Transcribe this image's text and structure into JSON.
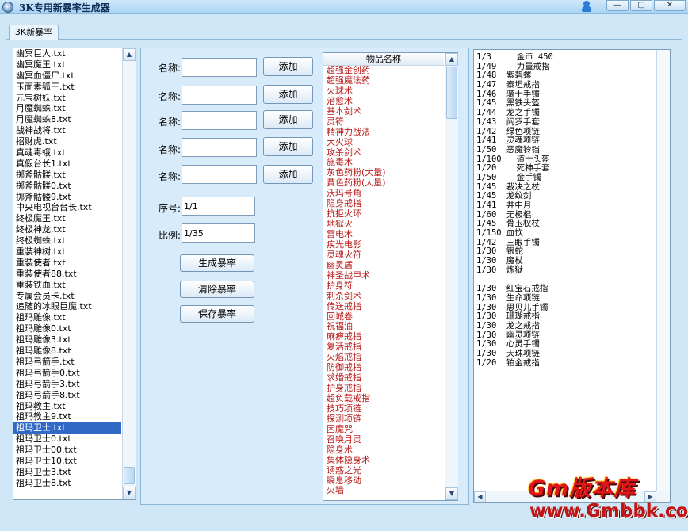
{
  "window": {
    "title": "3K专用新暴率生成器",
    "min_label": "—",
    "max_label": "▢",
    "close_label": "✕"
  },
  "tab": {
    "label": "3K新暴率"
  },
  "file_list": {
    "items": [
      "幽冥巨人.txt",
      "幽冥魔王.txt",
      "幽冥血僵尸.txt",
      "玉面素狐王.txt",
      "元宝树妖.txt",
      "月魔蜘蛛.txt",
      "月魔蜘蛛8.txt",
      "战神战将.txt",
      "招财虎.txt",
      "真魂毒蛾.txt",
      "真假台长1.txt",
      "掷斧骷髅.txt",
      "掷斧骷髅0.txt",
      "掷斧骷髅9.txt",
      "中央电视台台长.txt",
      "终极魔王.txt",
      "终极神龙.txt",
      "终极蜘蛛.txt",
      "重装神树.txt",
      "重装使者.txt",
      "重装使者88.txt",
      "重装铁血.txt",
      "专属会员卡.txt",
      "追随的冰眼巨魔.txt",
      "祖玛雕像.txt",
      "祖玛雕像0.txt",
      "祖玛雕像3.txt",
      "祖玛雕像8.txt",
      "祖玛弓箭手.txt",
      "祖玛弓箭手0.txt",
      "祖玛弓箭手3.txt",
      "祖玛弓箭手8.txt",
      "祖玛教主.txt",
      "祖玛教主9.txt",
      "祖玛卫士.txt",
      "祖玛卫士0.txt",
      "祖玛卫士00.txt",
      "祖玛卫士10.txt",
      "祖玛卫士3.txt",
      "祖玛卫士8.txt"
    ],
    "selected_index": 34
  },
  "form": {
    "name_label": "名称:",
    "add_label": "添加",
    "name_values": [
      "",
      "",
      "",
      "",
      ""
    ],
    "seq_label": "序号:",
    "seq_value": "1/1",
    "ratio_label": "比例:",
    "ratio_value": "1/35",
    "generate_label": "生成暴率",
    "clear_label": "清除暴率",
    "save_label": "保存暴率"
  },
  "items": {
    "header": "物品名称",
    "list": [
      "超强金创药",
      "超强魔法药",
      "火球术",
      "治愈术",
      "基本剑术",
      "灵符",
      "精神力战法",
      "大火球",
      "攻杀剑术",
      "施毒术",
      "灰色药粉(大量)",
      "黄色药粉(大量)",
      "沃玛号角",
      "隐身戒指",
      "抗拒火环",
      "地狱火",
      "雷电术",
      "疾光电影",
      "灵魂火符",
      "幽灵盾",
      "神圣战甲术",
      "护身符",
      "刺杀剑术",
      "传送戒指",
      "回城卷",
      "祝福油",
      "麻痹戒指",
      "复活戒指",
      "火焰戒指",
      "防御戒指",
      "求婚戒指",
      "护身戒指",
      "超负载戒指",
      "技巧项链",
      "探测项链",
      "困魔咒",
      "召唤月灵",
      "隐身术",
      "集体隐身术",
      "诱惑之光",
      "瞬息移动",
      "火墙"
    ]
  },
  "rates": {
    "lines": [
      "1/3     金币 450",
      "1/49    力量戒指",
      "1/48  紫碧螺",
      "1/47  泰坦戒指",
      "1/46  骑士手镯",
      "1/45  黑铁头盔",
      "1/44  龙之手镯",
      "1/43  阎罗手套",
      "1/42  绿色项链",
      "1/41  灵魂项链",
      "1/50  恶魔铃铛",
      "1/100   道士头盔",
      "1/20    死神手套",
      "1/50    金手镯",
      "1/45  裁决之杖",
      "1/45  龙纹剑",
      "1/41  井中月",
      "1/60  无极棍",
      "1/45  骨玉权杖",
      "1/150 血饮",
      "1/42  三眼手镯",
      "1/30  银蛇",
      "1/30  魔杖",
      "1/30  炼狱",
      "",
      "1/30  红宝石戒指",
      "1/30  生命项链",
      "1/30  思贝儿手镯",
      "1/30  珊瑚戒指",
      "1/30  龙之戒指",
      "1/30  幽灵项链",
      "1/30  心灵手镯",
      "1/30  天珠项链",
      "1/20  铂金戒指"
    ]
  },
  "watermark": {
    "brand": "Gm版本库",
    "url": "www.Gmbbk.com"
  },
  "icons": {
    "up": "▲",
    "down": "▼",
    "left": "◀",
    "right": "▶"
  }
}
